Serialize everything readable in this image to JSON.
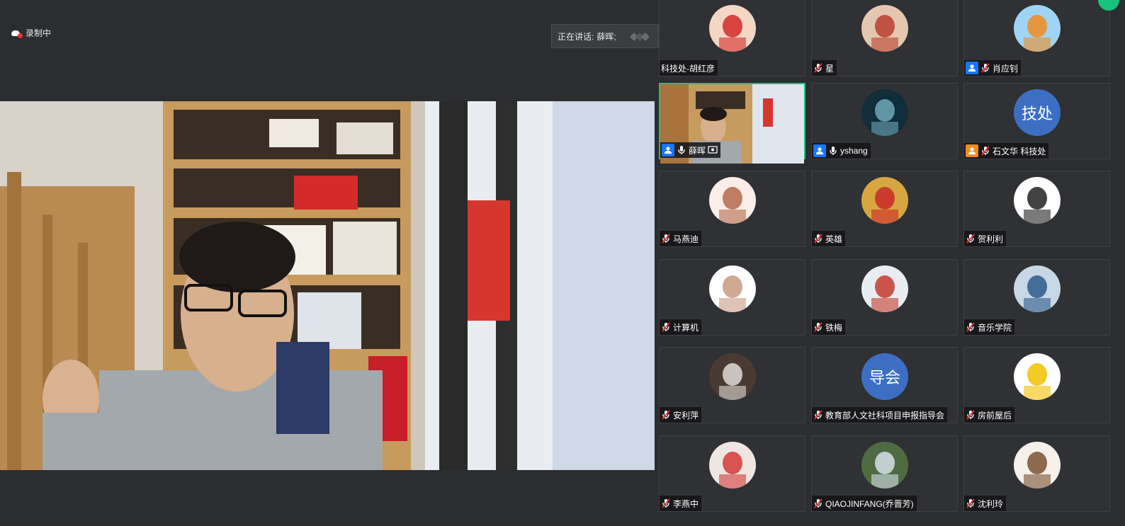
{
  "recording": {
    "label": "录制中"
  },
  "speaker_banner": {
    "prefix": "正在讲话:",
    "name": "薛晖;"
  },
  "participants": [
    {
      "name": "科技处-胡红彦",
      "mic": "none",
      "badge": "none",
      "avatar": "photo-red"
    },
    {
      "name": "星",
      "mic": "muted",
      "badge": "none",
      "avatar": "photo-santa"
    },
    {
      "name": "肖应钊",
      "mic": "muted",
      "badge": "host",
      "avatar": "photo-balloon"
    },
    {
      "name": "薛晖",
      "mic": "on",
      "badge": "host",
      "avatar": "video",
      "active": true
    },
    {
      "name": "yshang",
      "mic": "on",
      "badge": "host",
      "avatar": "photo-ocean"
    },
    {
      "name": "石文华 科技处",
      "mic": "muted",
      "badge": "cohost",
      "avatar": "text",
      "avatar_text": "技处"
    },
    {
      "name": "马燕迪",
      "mic": "muted",
      "badge": "none",
      "avatar": "photo-cartoon-girl"
    },
    {
      "name": "英雄",
      "mic": "muted",
      "badge": "none",
      "avatar": "photo-hat-man"
    },
    {
      "name": "贺利利",
      "mic": "muted",
      "badge": "none",
      "avatar": "photo-sketch"
    },
    {
      "name": "计算机",
      "mic": "muted",
      "badge": "none",
      "avatar": "photo-small"
    },
    {
      "name": "铁梅",
      "mic": "muted",
      "badge": "none",
      "avatar": "photo-red-hat"
    },
    {
      "name": "音乐学院",
      "mic": "muted",
      "badge": "none",
      "avatar": "photo-classroom"
    },
    {
      "name": "安利萍",
      "mic": "muted",
      "badge": "none",
      "avatar": "photo-headphones"
    },
    {
      "name": "教育部人文社科项目申报指导会",
      "mic": "muted",
      "badge": "none",
      "avatar": "text",
      "avatar_text": "导会"
    },
    {
      "name": "房前屋后",
      "mic": "muted",
      "badge": "none",
      "avatar": "photo-tiger"
    },
    {
      "name": "李燕中",
      "mic": "muted",
      "badge": "none",
      "avatar": "photo-flowers"
    },
    {
      "name": "QIAOJINFANG(乔晋芳)",
      "mic": "muted",
      "badge": "none",
      "avatar": "photo-forest"
    },
    {
      "name": "沈利玲",
      "mic": "muted",
      "badge": "none",
      "avatar": "photo-girl-hat"
    }
  ],
  "colors": {
    "background": "#2b2d30",
    "active_border": "#19c37d",
    "host_badge": "#1677ff",
    "cohost_badge": "#f08c21",
    "muted_mic": "#e0353f"
  }
}
